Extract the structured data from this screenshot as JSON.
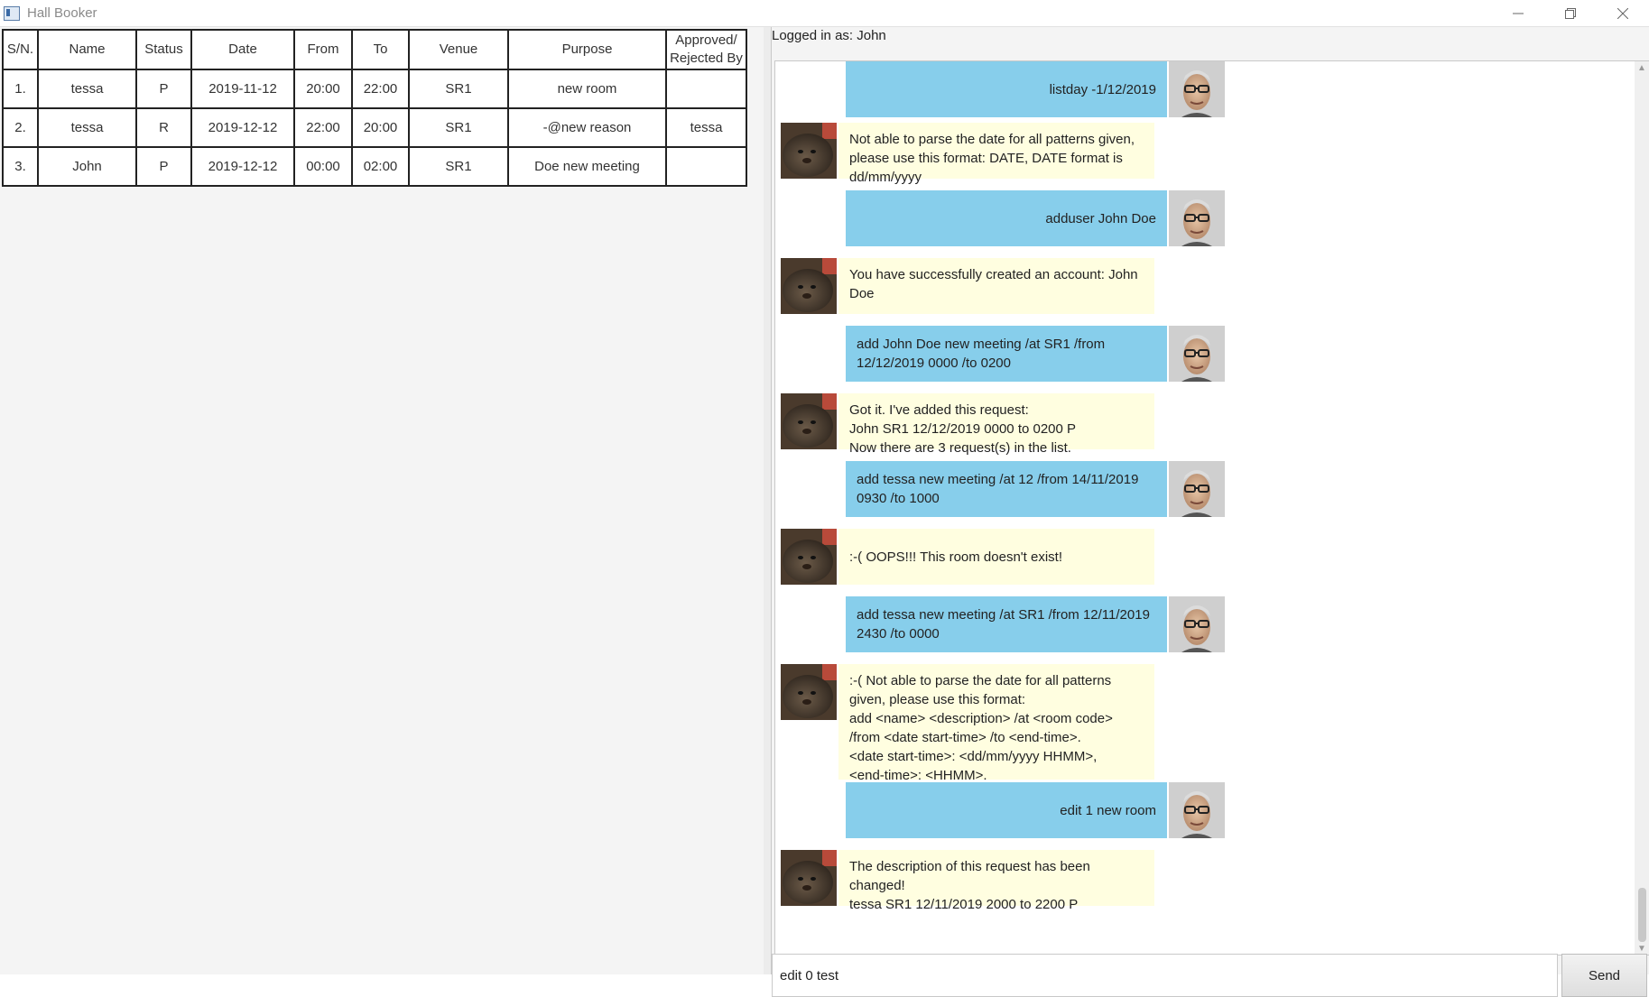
{
  "window": {
    "title": "Hall Booker"
  },
  "table": {
    "headers": [
      "S/N.",
      "Name",
      "Status",
      "Date",
      "From",
      "To",
      "Venue",
      "Purpose",
      "Approved/\nRejected By"
    ],
    "rows": [
      [
        "1.",
        "tessa",
        "P",
        "2019-11-12",
        "20:00",
        "22:00",
        "SR1",
        "new room",
        ""
      ],
      [
        "2.",
        "tessa",
        "R",
        "2019-12-12",
        "22:00",
        "20:00",
        "SR1",
        "-@new reason",
        "tessa"
      ],
      [
        "3.",
        "John",
        "P",
        "2019-12-12",
        "00:00",
        "02:00",
        "SR1",
        "Doe new meeting",
        ""
      ]
    ]
  },
  "session": {
    "logged_in": "Logged in as: John"
  },
  "chat": [
    {
      "from": "user",
      "text": "listday -1/12/2019"
    },
    {
      "from": "bot",
      "text": "Not able to parse the date for all patterns given,\nplease use this format: DATE, DATE format is\ndd/mm/yyyy"
    },
    {
      "from": "user",
      "text": "adduser John Doe"
    },
    {
      "from": "bot",
      "text": "You have successfully created an account: John\nDoe"
    },
    {
      "from": "user",
      "text": "add John Doe new meeting /at SR1 /from\n12/12/2019 0000 /to 0200"
    },
    {
      "from": "bot",
      "text": "Got it. I've added this request:\nJohn SR1 12/12/2019 0000 to 0200 P\nNow there are 3 request(s) in the list."
    },
    {
      "from": "user",
      "text": "add tessa new meeting /at 12 /from 14/11/2019\n0930 /to 1000"
    },
    {
      "from": "bot",
      "text": ":-( OOPS!!! This room doesn't exist!"
    },
    {
      "from": "user",
      "text": "add tessa new meeting /at SR1 /from 12/11/2019\n2430 /to 0000"
    },
    {
      "from": "bot",
      "text": ":-( Not able to parse the date for all patterns\ngiven, please use this format:\nadd <name> <description> /at <room code>\n/from <date start-time> /to <end-time>.\n<date start-time>: <dd/mm/yyyy HHMM>,\n<end-time>: <HHMM>."
    },
    {
      "from": "user",
      "text": "edit 1 new room"
    },
    {
      "from": "bot",
      "text": "The description of this request has been\nchanged!\ntessa SR1 12/11/2019 2000 to 2200 P"
    }
  ],
  "input": {
    "value": "edit 0 test"
  },
  "send_button": {
    "label": "Send"
  },
  "colors": {
    "user_bubble": "#87ceeb",
    "bot_bubble": "#fffee0"
  }
}
